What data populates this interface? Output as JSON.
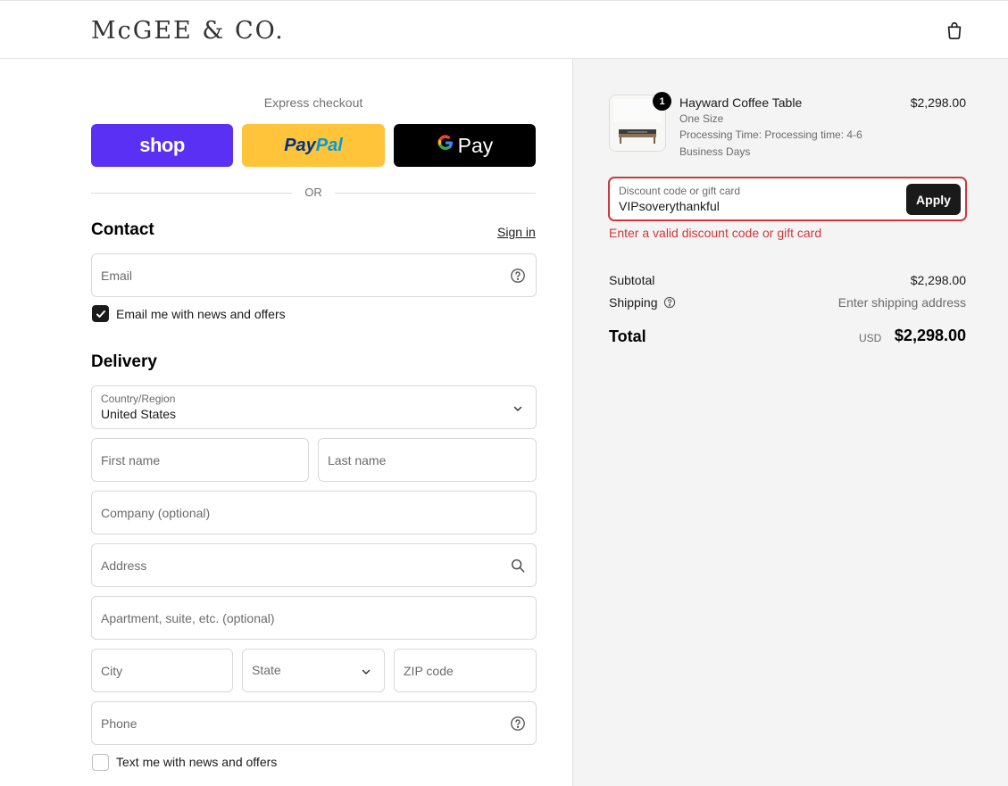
{
  "header": {
    "logo": "McGEE & CO.",
    "cart_icon": "shopping-bag-icon"
  },
  "express": {
    "label": "Express checkout",
    "shop_label": "shop",
    "paypal_part1": "Pay",
    "paypal_part2": "Pal",
    "gpay_g": "G",
    "gpay_label": "Pay",
    "or_label": "OR"
  },
  "contact": {
    "title": "Contact",
    "sign_in": "Sign in",
    "email_placeholder": "Email",
    "news_checkbox_label": "Email me with news and offers",
    "news_checked": true
  },
  "delivery": {
    "title": "Delivery",
    "country_label": "Country/Region",
    "country_value": "United States",
    "first_name_placeholder": "First name",
    "last_name_placeholder": "Last name",
    "company_placeholder": "Company (optional)",
    "address_placeholder": "Address",
    "apartment_placeholder": "Apartment, suite, etc. (optional)",
    "city_placeholder": "City",
    "state_placeholder": "State",
    "zip_placeholder": "ZIP code",
    "phone_placeholder": "Phone",
    "text_checkbox_label": "Text me with news and offers",
    "text_checked": false
  },
  "summary": {
    "product": {
      "quantity": "1",
      "name": "Hayward Coffee Table",
      "variant": "One Size",
      "processing_line1": "Processing Time: Processing time: 4-6",
      "processing_line2": "Business Days",
      "price": "$2,298.00"
    },
    "discount": {
      "label": "Discount code or gift card",
      "value": "VIPsoverythankful",
      "apply_label": "Apply",
      "error": "Enter a valid discount code or gift card"
    },
    "subtotal_label": "Subtotal",
    "subtotal_value": "$2,298.00",
    "shipping_label": "Shipping",
    "shipping_value": "Enter shipping address",
    "total_label": "Total",
    "total_currency": "USD",
    "total_value": "$2,298.00"
  },
  "colors": {
    "shop_purple": "#5a31f4",
    "paypal_yellow": "#ffc439",
    "error_red": "#d0373d",
    "summary_bg": "#f4f4f4"
  }
}
